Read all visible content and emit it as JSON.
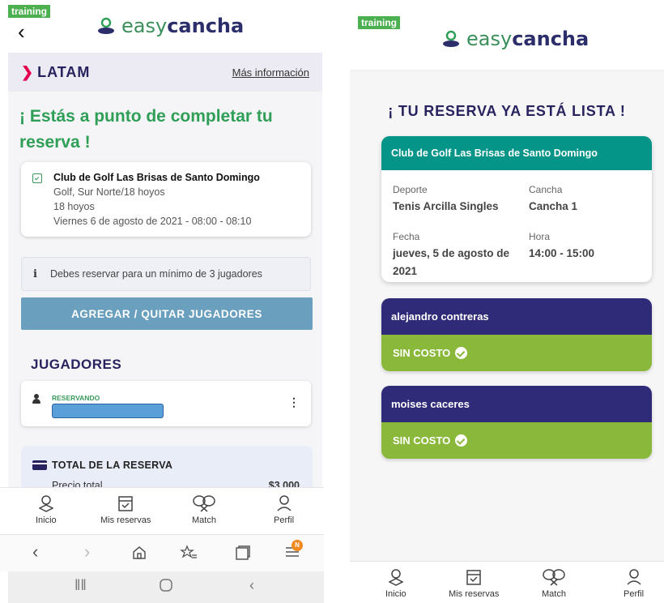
{
  "left": {
    "badge": "training",
    "brand": {
      "prefix": "easy",
      "suffix": "cancha"
    },
    "partner": {
      "name": "LATAM",
      "link": "Más información"
    },
    "headline": "¡ Estás a punto de completar tu reserva !",
    "club": {
      "name": "Club de Golf Las Brisas de Santo Domingo",
      "line1": "Golf, Sur Norte/18 hoyos",
      "line2": "18 hoyos",
      "line3": "Viernes 6 de agosto de 2021 - 08:00 - 08:10"
    },
    "info": "Debes reservar para un mínimo de 3 jugadores",
    "add_button": "AGREGAR / QUITAR JUGADORES",
    "players_title": "JUGADORES",
    "player": {
      "role": "RESERVANDO"
    },
    "total": {
      "title": "TOTAL DE LA RESERVA",
      "label": "Precio total",
      "value": "$3.000"
    },
    "nav": [
      "Inicio",
      "Mis reservas",
      "Match",
      "Perfil"
    ],
    "browser": {
      "notification": "N"
    }
  },
  "right": {
    "badge": "training",
    "brand": {
      "prefix": "easy",
      "suffix": "cancha"
    },
    "title": "¡ TU RESERVA YA ESTÁ LISTA !",
    "club": "Club de Golf Las Brisas de Santo Domingo",
    "deporte": {
      "label": "Deporte",
      "value": "Tenis Arcilla Singles"
    },
    "cancha": {
      "label": "Cancha",
      "value": "Cancha 1"
    },
    "fecha": {
      "label": "Fecha",
      "value": "jueves, 5 de agosto de 2021"
    },
    "hora": {
      "label": "Hora",
      "value": "14:00 - 15:00"
    },
    "players": [
      {
        "name": "alejandro contreras",
        "cost": "SIN COSTO"
      },
      {
        "name": "moises caceres",
        "cost": "SIN COSTO"
      }
    ],
    "nav": [
      "Inicio",
      "Mis reservas",
      "Match",
      "Perfil"
    ]
  },
  "colors": {
    "brand_navy": "#27235f",
    "green_headline": "#2f9e57",
    "teal_header": "#059488",
    "player_purple": "#2f2b78",
    "cost_green": "#8ab83a",
    "button_blue": "#6a9fbd",
    "latam_magenta": "#e5004f"
  },
  "icons": [
    "back-arrow-icon",
    "location-pin-icon",
    "calendar-icon",
    "info-icon",
    "person-icon",
    "more-vertical-icon",
    "credit-card-icon",
    "rackets-icon",
    "profile-icon",
    "home-icon",
    "star-list-icon",
    "tabs-icon",
    "menu-icon",
    "recents-icon",
    "check-circle-icon"
  ]
}
